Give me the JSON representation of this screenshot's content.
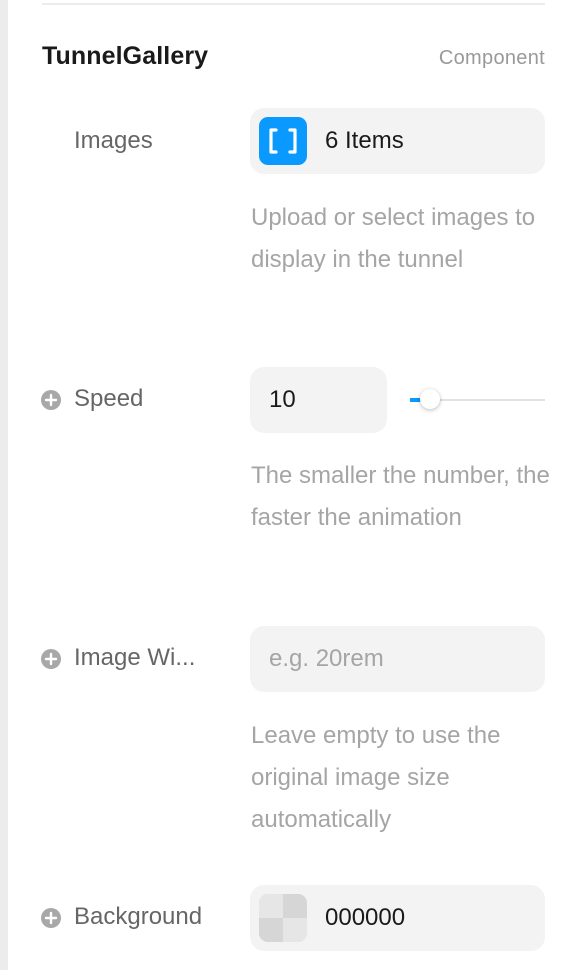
{
  "component": {
    "name": "TunnelGallery",
    "type_label": "Component"
  },
  "properties": {
    "images": {
      "label": "Images",
      "value": "6 Items",
      "icon": "array-brackets-icon",
      "hint": "Upload or select images to display in the tunnel"
    },
    "speed": {
      "label": "Speed",
      "value": "10",
      "slider_fraction": 0.1,
      "hint": "The smaller the number, the faster the animation"
    },
    "image_width": {
      "label": "Image Wi...",
      "placeholder": "e.g. 20rem",
      "value": "",
      "hint": "Leave empty to use the original image size automatically"
    },
    "background": {
      "label": "Background",
      "value": "000000"
    }
  },
  "colors": {
    "accent": "#0a99ff",
    "field_bg": "#f3f3f3",
    "label": "#666666",
    "hint": "#a5a5a5"
  }
}
